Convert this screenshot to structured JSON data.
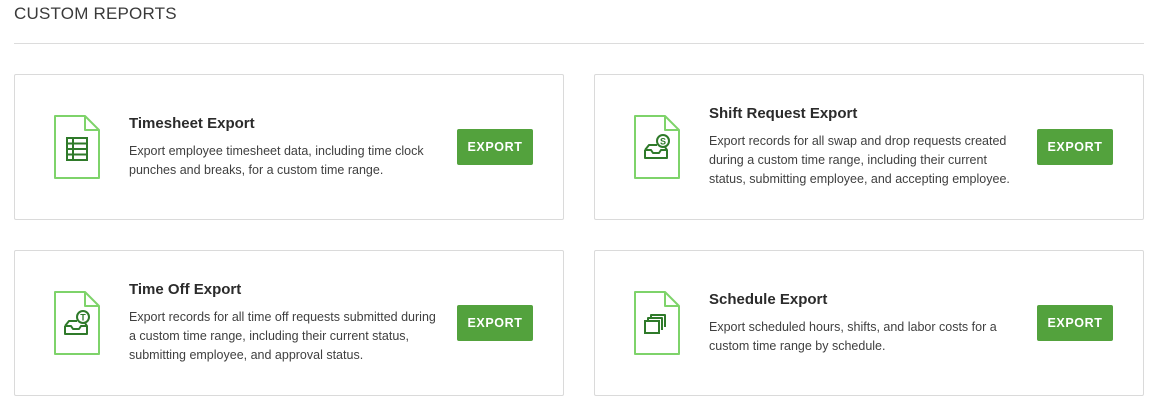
{
  "section": {
    "title": "CUSTOM REPORTS"
  },
  "colors": {
    "accent_green": "#53a23d",
    "icon_green": "#7ed36a",
    "icon_dark_green": "#2f7a2a"
  },
  "cards": [
    {
      "title": "Timesheet Export",
      "description": "Export employee timesheet data, including time clock punches and breaks, for a custom time range.",
      "icon": "timesheet-document-icon",
      "button_label": "EXPORT"
    },
    {
      "title": "Shift Request Export",
      "description": "Export records for all swap and drop requests created during a custom time range, including their current status, submitting employee, and accepting employee.",
      "icon": "shift-request-document-icon",
      "button_label": "EXPORT"
    },
    {
      "title": "Time Off Export",
      "description": "Export records for all time off requests submitted during a custom time range, including their current status, submitting employee, and approval status.",
      "icon": "time-off-document-icon",
      "button_label": "EXPORT"
    },
    {
      "title": "Schedule Export",
      "description": "Export scheduled hours, shifts, and labor costs for a custom time range by schedule.",
      "icon": "schedule-document-icon",
      "button_label": "EXPORT"
    }
  ]
}
